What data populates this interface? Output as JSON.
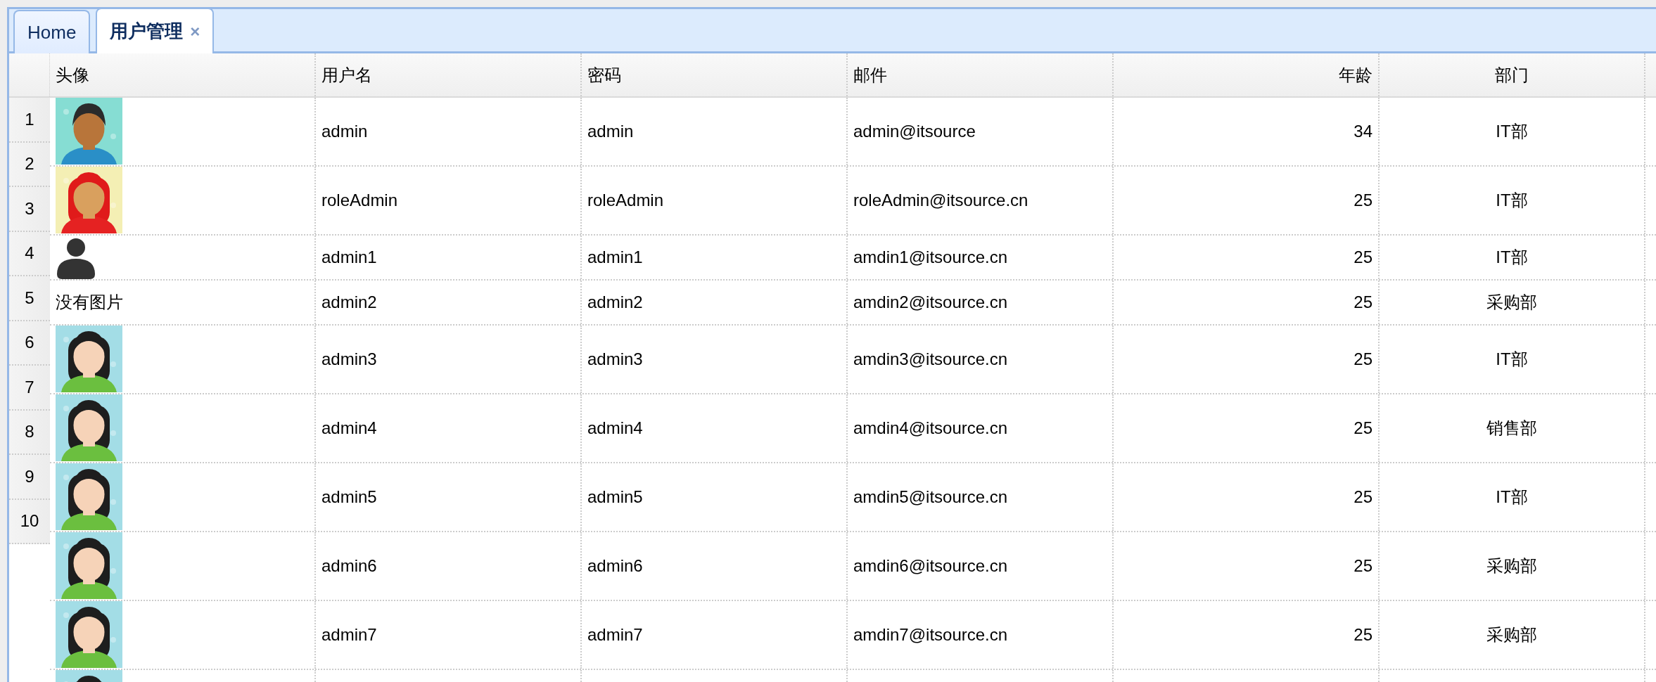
{
  "tabs": [
    {
      "label": "Home",
      "selected": false
    },
    {
      "label": "用户管理",
      "selected": true,
      "close": "×"
    }
  ],
  "table": {
    "columns": [
      {
        "label": "头像"
      },
      {
        "label": "用户名"
      },
      {
        "label": "密码"
      },
      {
        "label": "邮件"
      },
      {
        "label": "年龄"
      },
      {
        "label": "部门"
      }
    ],
    "row_numbers": [
      "1",
      "2",
      "3",
      "4",
      "5",
      "6",
      "7",
      "8",
      "9",
      "10"
    ],
    "rows": [
      {
        "avatar": {
          "kind": "picture"
        },
        "username": "admin",
        "password": "admin",
        "email": "admin@itsource",
        "age": "34",
        "department": "IT部"
      },
      {
        "avatar": {
          "kind": "picture"
        },
        "username": "roleAdmin",
        "password": "roleAdmin",
        "email": "roleAdmin@itsource.cn",
        "age": "25",
        "department": "IT部"
      },
      {
        "avatar": {
          "kind": "icon"
        },
        "username": "admin1",
        "password": "admin1",
        "email": "amdin1@itsource.cn",
        "age": "25",
        "department": "IT部"
      },
      {
        "avatar": {
          "kind": "text",
          "text": "没有图片"
        },
        "username": "admin2",
        "password": "admin2",
        "email": "amdin2@itsource.cn",
        "age": "25",
        "department": "采购部"
      },
      {
        "avatar": {
          "kind": "picture"
        },
        "username": "admin3",
        "password": "admin3",
        "email": "amdin3@itsource.cn",
        "age": "25",
        "department": "IT部"
      },
      {
        "avatar": {
          "kind": "picture"
        },
        "username": "admin4",
        "password": "admin4",
        "email": "amdin4@itsource.cn",
        "age": "25",
        "department": "销售部"
      },
      {
        "avatar": {
          "kind": "picture"
        },
        "username": "admin5",
        "password": "admin5",
        "email": "amdin5@itsource.cn",
        "age": "25",
        "department": "IT部"
      },
      {
        "avatar": {
          "kind": "picture"
        },
        "username": "admin6",
        "password": "admin6",
        "email": "amdin6@itsource.cn",
        "age": "25",
        "department": "采购部"
      },
      {
        "avatar": {
          "kind": "picture"
        },
        "username": "admin7",
        "password": "admin7",
        "email": "amdin7@itsource.cn",
        "age": "25",
        "department": "采购部"
      },
      {
        "avatar": {
          "kind": "picture"
        }
      }
    ]
  }
}
